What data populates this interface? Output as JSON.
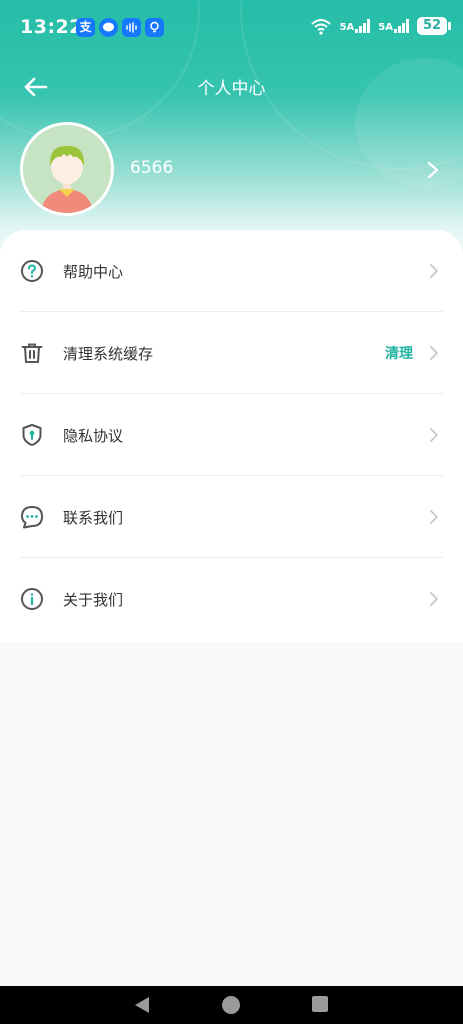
{
  "status_bar": {
    "time": "13:22",
    "notification_icons": [
      "alipay-icon",
      "message-icon",
      "voice-icon",
      "bulb-icon"
    ],
    "signal_1": "5A",
    "signal_2": "5A",
    "battery": "52"
  },
  "header": {
    "title": "个人中心",
    "username": "6566"
  },
  "menu": {
    "items": [
      {
        "label": "帮助中心",
        "icon": "help-icon",
        "extra": ""
      },
      {
        "label": "清理系统缓存",
        "icon": "trash-icon",
        "extra": "清理"
      },
      {
        "label": "隐私协议",
        "icon": "shield-icon",
        "extra": ""
      },
      {
        "label": "联系我们",
        "icon": "chat-icon",
        "extra": ""
      },
      {
        "label": "关于我们",
        "icon": "info-icon",
        "extra": ""
      }
    ]
  },
  "colors": {
    "accent": "#22b3a2",
    "header_top": "#24bda7",
    "icon": "#555555",
    "arrow": "#c8c8c8"
  }
}
